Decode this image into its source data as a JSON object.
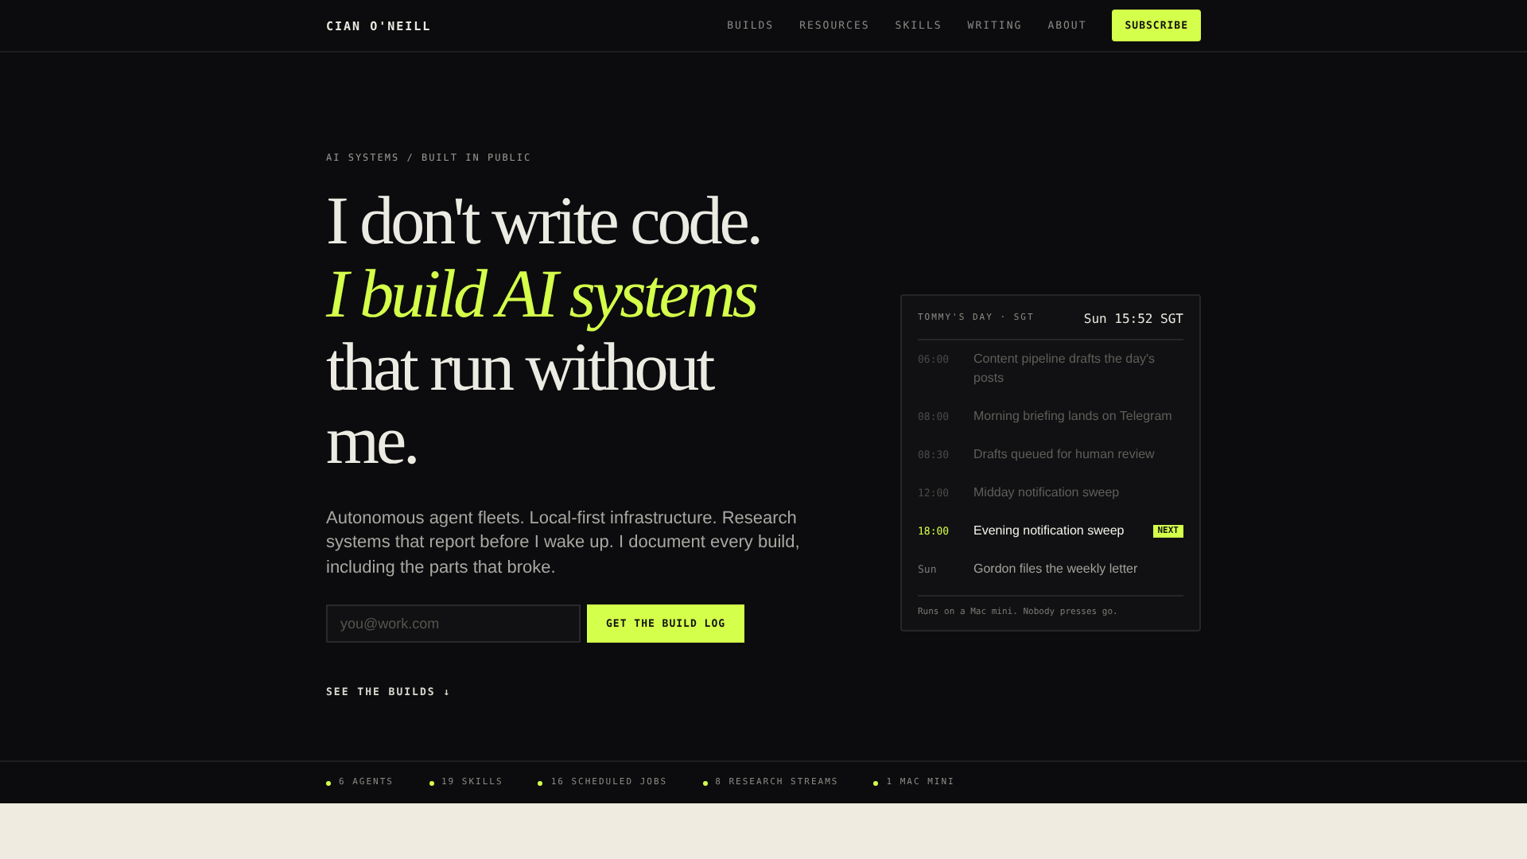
{
  "nav": {
    "brand": "CIAN O'NEILL",
    "links": [
      "BUILDS",
      "RESOURCES",
      "SKILLS",
      "WRITING",
      "ABOUT"
    ],
    "cta": "SUBSCRIBE"
  },
  "hero": {
    "eyebrow": "AI SYSTEMS / BUILT IN PUBLIC",
    "headline": [
      "I don't write code."
    ],
    "headline_accent": "I build AI systems",
    "headline_end": [
      "that run without",
      "me."
    ],
    "lede": "Autonomous agent fleets. Local-first infrastructure. Research systems that report before I wake up. I document every build, including the parts that broke.",
    "email": {
      "placeholder": "you@work.com"
    },
    "submit": "GET THE BUILD LOG",
    "secondary": "SEE THE BUILDS ↓"
  },
  "schedule": {
    "title": "TOMMY'S DAY · SGT",
    "clock": "Sun 15:52 SGT",
    "items": [
      {
        "time": "06:00",
        "task": "Content pipeline drafts the day's posts",
        "done": true,
        "selected": false
      },
      {
        "time": "08:00",
        "task": "Morning briefing lands on Telegram",
        "done": true,
        "selected": false
      },
      {
        "time": "08:30",
        "task": "Drafts queued for human review",
        "done": true,
        "selected": false
      },
      {
        "time": "12:00",
        "task": "Midday notification sweep",
        "done": true,
        "selected": false
      },
      {
        "time": "18:00",
        "task": "Evening notification sweep",
        "done": false,
        "selected": true,
        "badge": "NEXT"
      },
      {
        "time": "Sun",
        "task": "Gordon files the weekly letter",
        "done": false,
        "selected": false
      }
    ],
    "footer": "Runs on a Mac mini. Nobody presses go."
  },
  "stats": [
    "6 AGENTS",
    "19 SKILLS",
    "16 SCHEDULED JOBS",
    "8 RESEARCH STREAMS",
    "1 MAC MINI"
  ]
}
